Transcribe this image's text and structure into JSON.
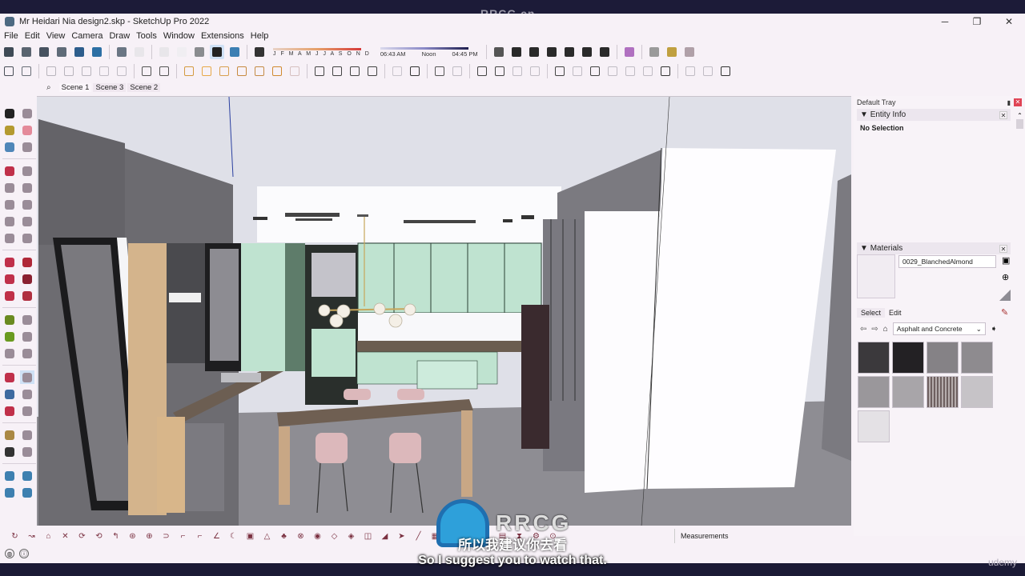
{
  "watermark_top": "RRCG.cn",
  "window": {
    "title": "Mr Heidari Nia design2.skp - SketchUp Pro 2022",
    "controls": {
      "minimize": "─",
      "restore": "❐",
      "close": "✕"
    }
  },
  "menu": [
    "File",
    "Edit",
    "View",
    "Camera",
    "Draw",
    "Tools",
    "Window",
    "Extensions",
    "Help"
  ],
  "toolbar1": {
    "groups": [
      [
        "component-icon",
        "section-icon",
        "group-icon",
        "layer-icon",
        "solid-icon",
        "solid2-icon"
      ],
      [
        "xray-icon",
        "back-edges-icon"
      ],
      [
        "wireframe-icon",
        "hidden-line-icon",
        "shaded-icon",
        "shaded-textures-icon",
        "monochrome-icon"
      ],
      [
        "shadows-toggle-icon"
      ]
    ],
    "shadow_months": "J F M A M J J A S O N D",
    "shadow_times": {
      "start": "06:43 AM",
      "mid": "Noon",
      "end": "04:45 PM"
    },
    "group_right": [
      "fog-icon",
      "iso-icon",
      "top-view-icon",
      "front-view-icon",
      "right-view-icon",
      "back-view-icon",
      "left-view-icon"
    ],
    "extra": [
      "extension-warehouse-icon",
      "sandbox-icon",
      "location-icon",
      "styles-icon"
    ]
  },
  "toolbar2": {
    "icons": [
      "outer-shell-icon",
      "intersect-icon",
      "union-icon",
      "subtract-icon",
      "trim-icon",
      "split-icon",
      "solid-tools-icon",
      "make-component-icon",
      "paint-bucket-icon",
      "follow-me-icon",
      "offset-icon",
      "protractor-icon",
      "axes-icon",
      "dimension-icon",
      "section-plane-icon",
      "display-section-icon",
      "style-check-icon",
      "material-icon",
      "teapot-icon",
      "teapot2-icon",
      "rainbow-icon",
      "refresh-icon",
      "add-scene-icon",
      "scene-image-icon",
      "window-icon",
      "window-frame-icon",
      "window-shade-icon",
      "lock-icon",
      "sandbox-from-contours-icon",
      "cube-icon",
      "cube-dot-icon",
      "grass-icon",
      "smoove-icon",
      "grid-icon",
      "flip-edge-icon",
      "tiles-icon",
      "door-icon",
      "visibility-icon"
    ]
  },
  "scenes": {
    "search_icon": "search-icon",
    "tabs": [
      {
        "label": "Scene 1",
        "active": true
      },
      {
        "label": "Scene 3",
        "active": false
      },
      {
        "label": "Scene 2",
        "active": false
      }
    ]
  },
  "left_tools": [
    "select",
    "orbit-select",
    "make-component",
    "eraser",
    "paint-bucket",
    "tag-tool",
    "sep",
    "line",
    "freehand",
    "rectangle",
    "rotated-rectangle",
    "circle",
    "polygon",
    "arc",
    "3-point-arc",
    "pie",
    "2-point-arc",
    "sep",
    "move",
    "push-pull",
    "rotate",
    "follow-me",
    "scale",
    "offset",
    "sep",
    "tape-measure",
    "dimension",
    "protractor",
    "text",
    "axes",
    "3d-text",
    "sep",
    "orbit",
    "pan",
    "zoom",
    "zoom-window",
    "zoom-extents",
    "position-camera",
    "sep",
    "walk",
    "look-around",
    "footprints",
    "section-plane",
    "sep",
    "sandbox-smoove",
    "sandbox-stamp",
    "sandbox-drape",
    "sandbox-flip"
  ],
  "tray": {
    "title": "Default Tray",
    "entity_info": {
      "header": "Entity Info",
      "value": "No Selection"
    },
    "materials": {
      "header": "Materials",
      "current_name": "0029_BlanchedAlmond",
      "tabs": [
        {
          "label": "Select",
          "active": true
        },
        {
          "label": "Edit",
          "active": false
        }
      ],
      "library": "Asphalt and Concrete",
      "swatches": [
        "#3b393c",
        "#232124",
        "#858286",
        "#8e8b8f",
        "#9a979b",
        "#a8a5a9",
        "#7d7575",
        "#c6c3c7",
        "#e4e1e5"
      ]
    }
  },
  "bottom_toolbar": [
    "smoove-icon",
    "twist-icon",
    "paint-icon",
    "cross-icon",
    "rotate-icon",
    "rotate2-icon",
    "bend-icon",
    "ring-icon",
    "knot-icon",
    "spiral-icon",
    "corner-icon",
    "corner2-icon",
    "angle-icon",
    "curve-icon",
    "box-icon",
    "drop-icon",
    "fan-icon",
    "sphere-icon",
    "bulb-icon",
    "leaf-icon",
    "vane-icon",
    "flag-icon",
    "brush-icon",
    "arrow-icon",
    "line-tool-icon",
    "tile-icon",
    "wing-icon",
    "shell-icon",
    "wave-icon",
    "strip-icon",
    "mirror-icon",
    "gear-icon",
    "help-icon"
  ],
  "measurements_label": "Measurements",
  "status": {
    "icons": [
      "geo-location-icon",
      "info-icon"
    ]
  },
  "subtitle_en": "So I suggest you to watch that.",
  "subtitle_cn": "所以我建议你去看",
  "watermark_logo": "RRCG",
  "udemy": "udemy",
  "colors": {
    "accent_select": "#cfe1f5",
    "tray_close": "#e04455",
    "background": "#f7f1f7"
  }
}
